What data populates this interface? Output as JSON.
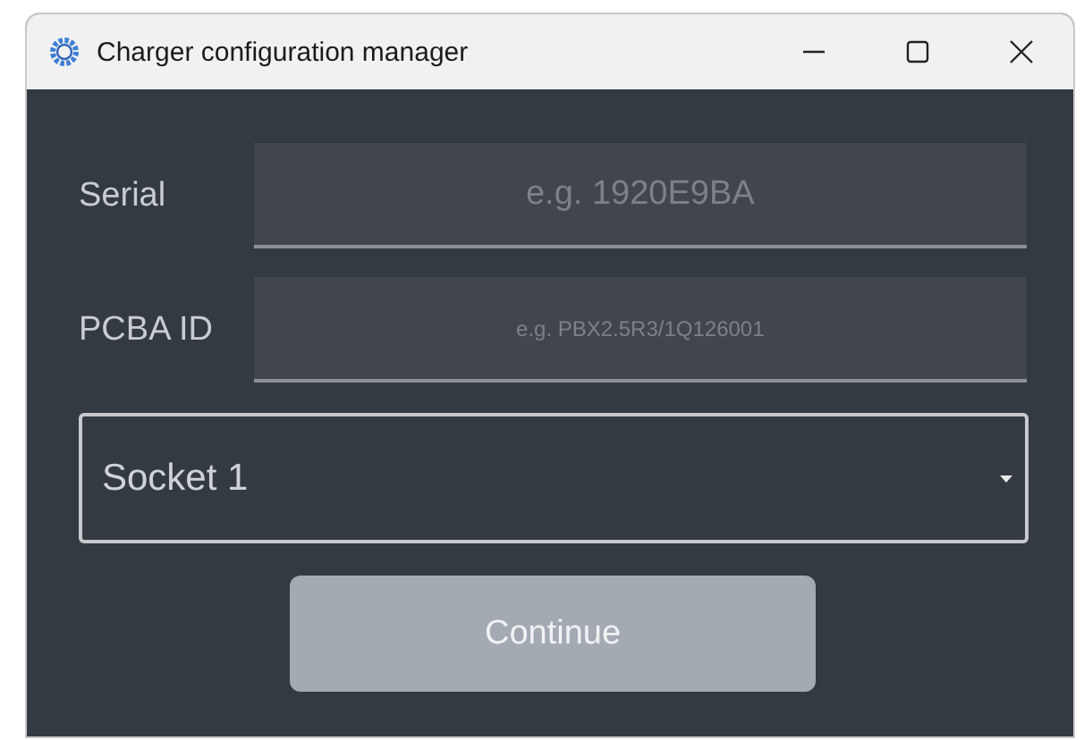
{
  "window": {
    "title": "Charger configuration manager"
  },
  "fields": [
    {
      "label": "Serial",
      "placeholder": "e.g. 1920E9BA"
    },
    {
      "label": "PCBA ID",
      "placeholder": "e.g. PBX2.5R3/1Q126001"
    }
  ],
  "dropdown": {
    "value": "Socket 1"
  },
  "button": {
    "label": "Continue",
    "disabled": true
  }
}
